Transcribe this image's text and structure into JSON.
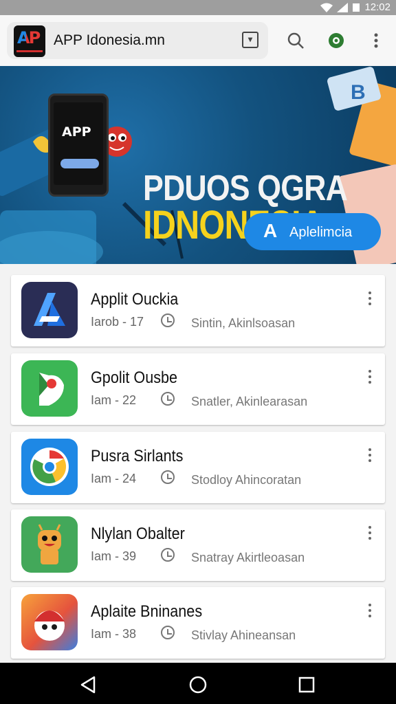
{
  "status_bar": {
    "time": "12:02"
  },
  "header": {
    "title": "APP Idonesia.mn",
    "tab_label": "▾"
  },
  "banner": {
    "line1": "PDUOS QGRA",
    "line2": "IDNONESIA",
    "phone_logo": "APP",
    "cta_icon": "A",
    "cta_label": "Aplelimcia"
  },
  "apps": [
    {
      "name": "Applit Ouckia",
      "meta": "Iarob - 17",
      "desc": "Sintin, Akinlsoasan",
      "icon": "azure-a-icon"
    },
    {
      "name": "Gpolit Ousbe",
      "meta": "Iam - 22",
      "desc": "Snatler, Akinlearasan",
      "icon": "green-flag-icon"
    },
    {
      "name": "Pusra Sirlants",
      "meta": "Iam - 24",
      "desc": "Stodloy Ahincoratan",
      "icon": "chrome-icon"
    },
    {
      "name": "Nlylan Obalter",
      "meta": "Iam - 39",
      "desc": "Snatray Akirtleoasan",
      "icon": "android-robot-icon"
    },
    {
      "name": "Aplaite Bninanes",
      "meta": "Iam - 38",
      "desc": "Stivlay Ahineansan",
      "icon": "mascot-icon"
    }
  ],
  "colors": {
    "accent": "#1e88e5",
    "banner_bg": "#13527f",
    "headline_yellow": "#f5d21d"
  }
}
